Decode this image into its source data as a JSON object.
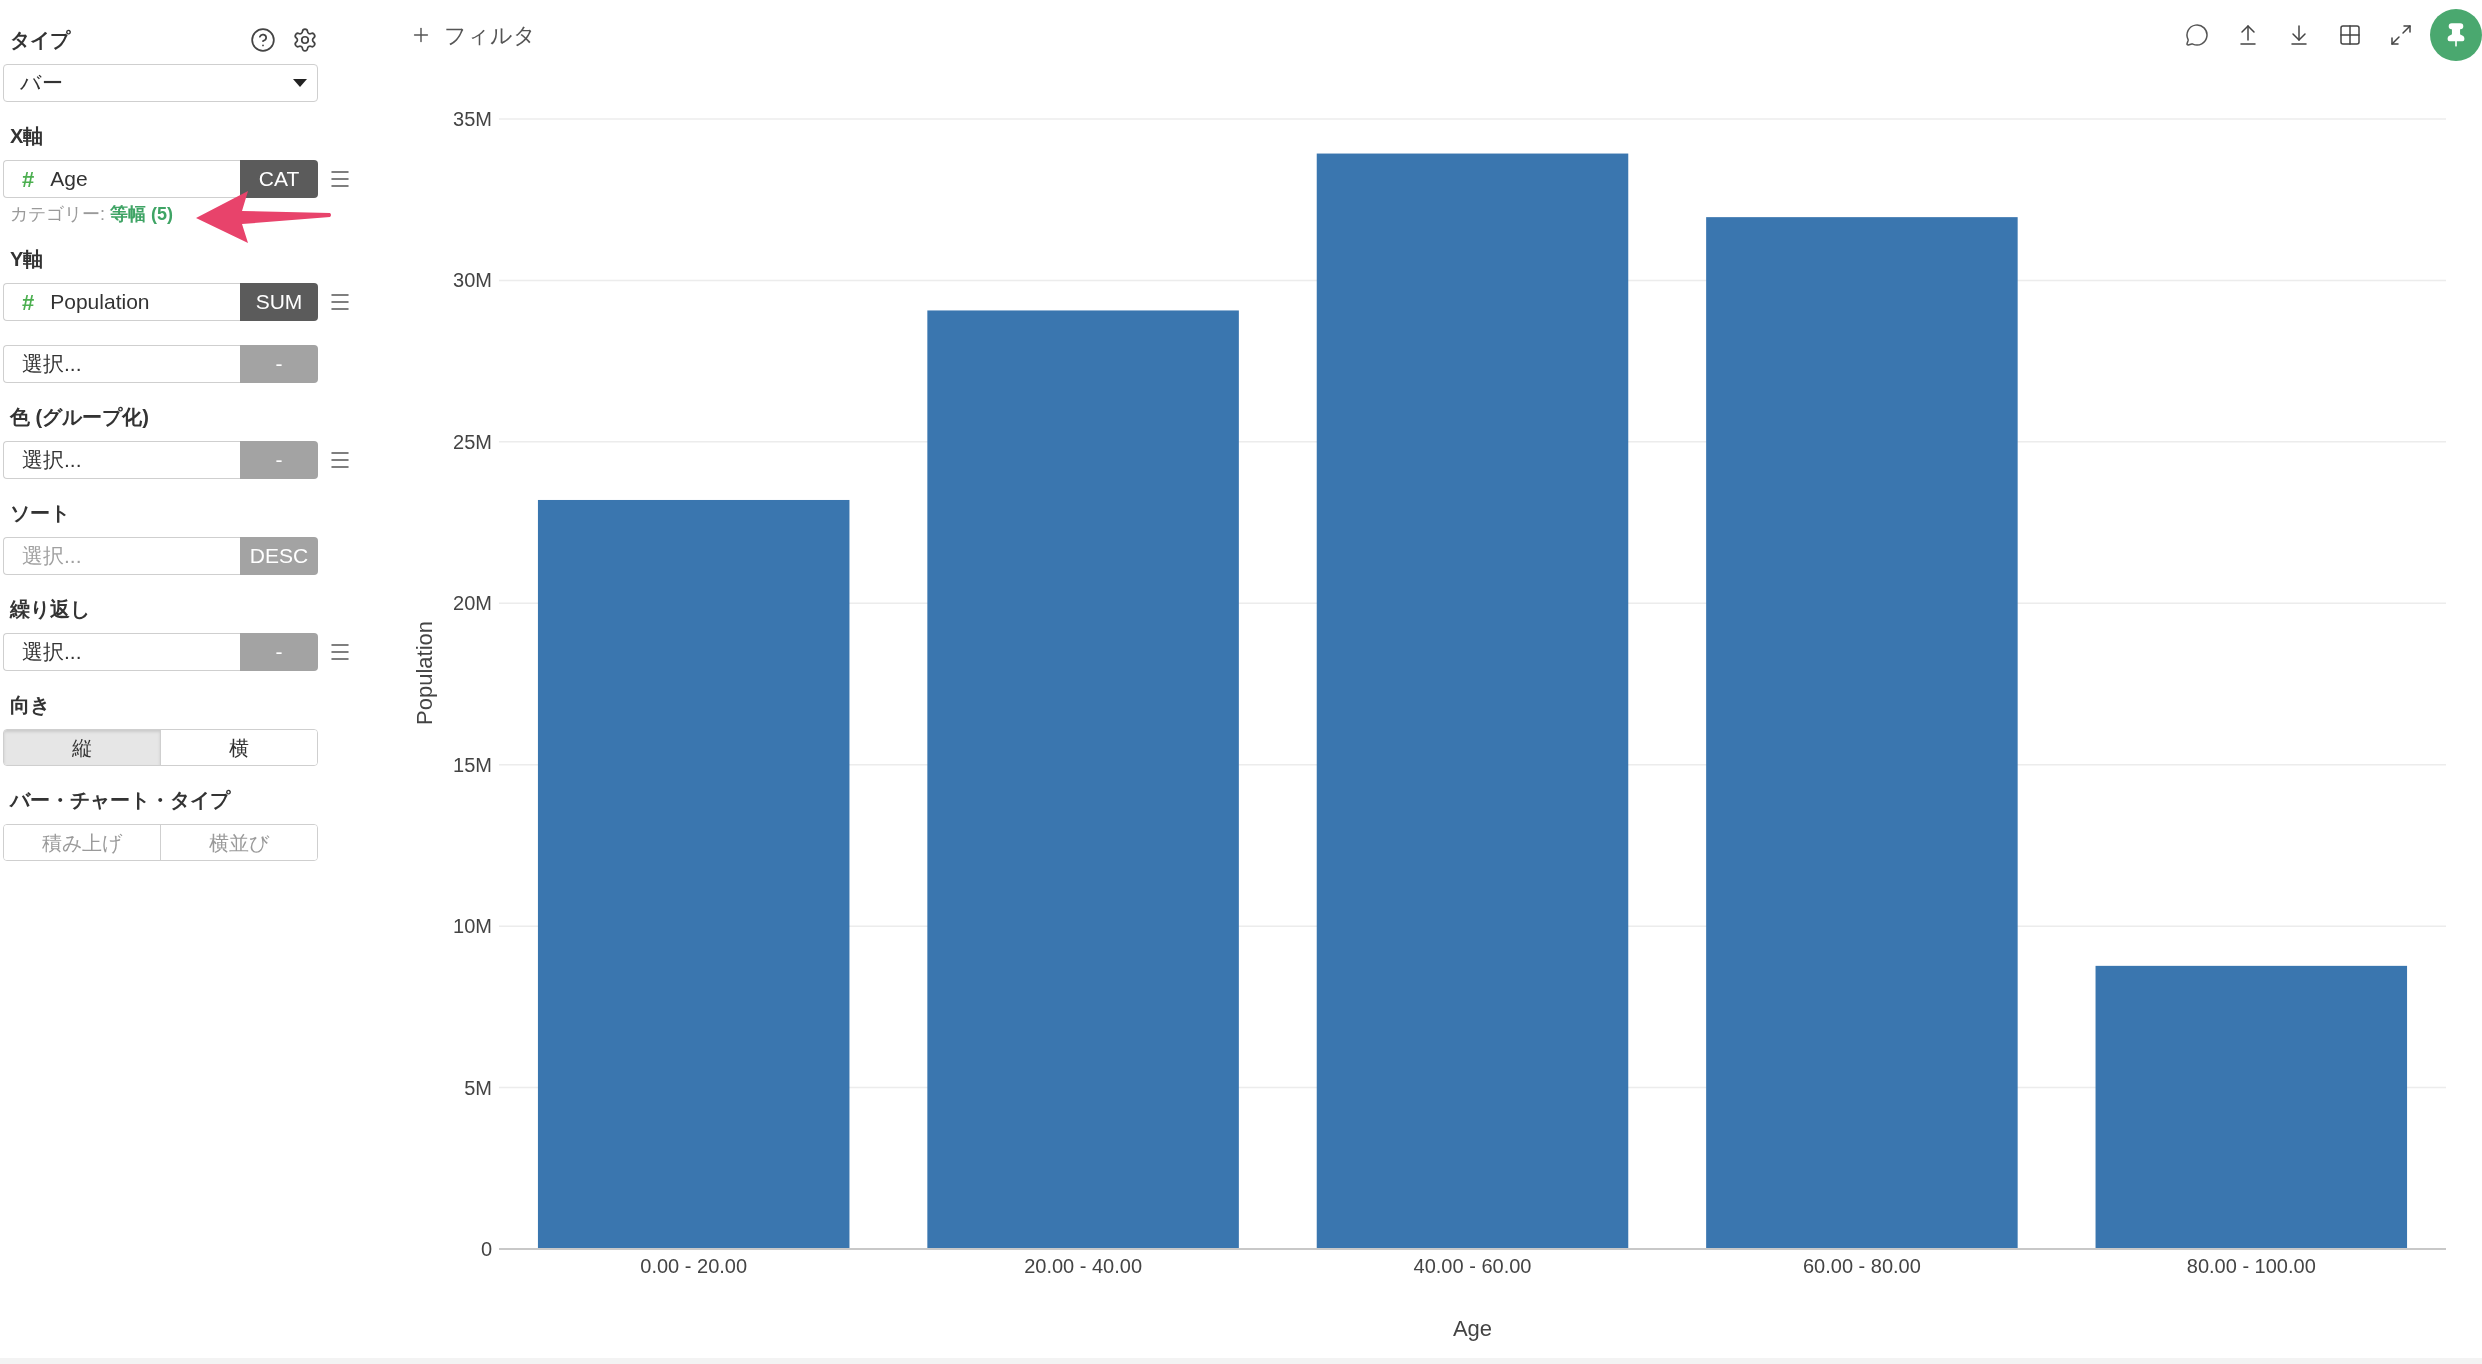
{
  "sidebar": {
    "type": {
      "label": "タイプ",
      "select": {
        "value": "バー"
      }
    },
    "sections": [
      {
        "kind": "fields",
        "label": "X軸",
        "fields": [
          {
            "glyph": "#",
            "value": "Age",
            "button": {
              "label": "CAT",
              "active": true
            },
            "menu": true
          }
        ],
        "note": {
          "text": "カテゴリー: ",
          "link": "等幅 (5)"
        }
      },
      {
        "kind": "fields",
        "label": "Y軸",
        "fields": [
          {
            "glyph": "#",
            "value": "Population",
            "button": {
              "label": "SUM",
              "active": true
            },
            "menu": true
          },
          {
            "value": "選択...",
            "button": {
              "label": "-",
              "active": false
            },
            "menu": false
          }
        ]
      },
      {
        "kind": "fields",
        "label": "色 (グループ化)",
        "fields": [
          {
            "value": "選択...",
            "button": {
              "label": "-",
              "active": false
            },
            "menu": true
          }
        ]
      },
      {
        "kind": "fields",
        "label": "ソート",
        "fields": [
          {
            "placeholder": "選択...",
            "button": {
              "label": "DESC",
              "active": false
            },
            "menu": false
          }
        ]
      },
      {
        "kind": "fields",
        "label": "繰り返し",
        "fields": [
          {
            "value": "選択...",
            "button": {
              "label": "-",
              "active": false
            },
            "menu": true
          }
        ]
      },
      {
        "kind": "segmented",
        "label": "向き",
        "disabled": false,
        "options": [
          {
            "label": "縦",
            "selected": true
          },
          {
            "label": "横",
            "selected": false
          }
        ]
      },
      {
        "kind": "segmented",
        "label": "バー・チャート・タイプ",
        "disabled": true,
        "options": [
          {
            "label": "積み上げ",
            "selected": false
          },
          {
            "label": "横並び",
            "selected": false
          }
        ]
      }
    ]
  },
  "toolbar": {
    "filter": {
      "label": "フィルタ"
    },
    "pinned": true
  },
  "chart": {
    "chart_data": {
      "type": "bar",
      "xlabel": "Age",
      "ylabel": "Population",
      "categories": [
        "0.00 - 20.00",
        "20.00 - 40.00",
        "40.00 - 60.00",
        "60.00 - 80.00",
        "80.00 - 100.00"
      ],
      "series": [
        {
          "color": "#3a76af",
          "values": [
            23200000,
            29070000,
            33930000,
            31960000,
            8770000
          ]
        }
      ],
      "ylim": [
        0,
        35000000
      ],
      "grid": true,
      "yticks": [
        {
          "value": 0,
          "label": "0"
        },
        {
          "value": 5000000,
          "label": "5M"
        },
        {
          "value": 10000000,
          "label": "10M"
        },
        {
          "value": 15000000,
          "label": "15M"
        },
        {
          "value": 20000000,
          "label": "20M"
        },
        {
          "value": 25000000,
          "label": "25M"
        },
        {
          "value": 30000000,
          "label": "30M"
        },
        {
          "value": 35000000,
          "label": "35M"
        }
      ]
    }
  }
}
